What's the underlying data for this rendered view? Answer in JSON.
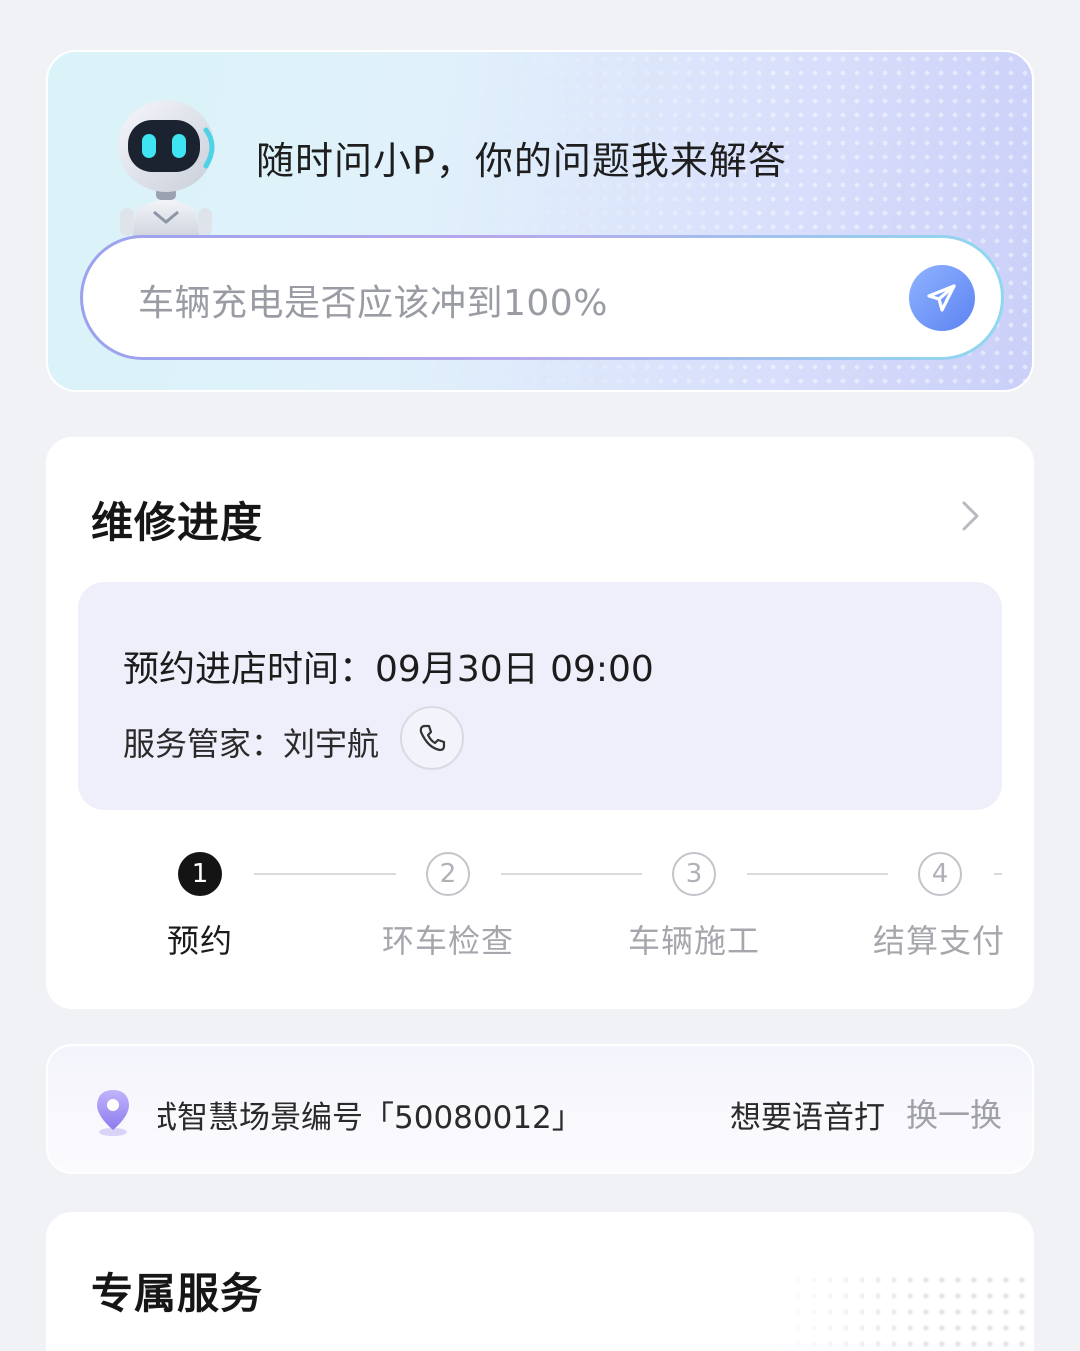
{
  "assistant": {
    "tagline": "随时问小P，你的问题我来解答",
    "input_placeholder": "车辆充电是否应该冲到100%",
    "send_icon": "paper-plane-icon"
  },
  "repair": {
    "title": "维修进度",
    "appointment_label": "预约进店时间：",
    "appointment_time": "09月30日 09:00",
    "advisor_label": "服务管家：",
    "advisor_name": "刘宇航",
    "steps": [
      {
        "num": "1",
        "label": "预约",
        "state": "active"
      },
      {
        "num": "2",
        "label": "环车检查",
        "state": "todo"
      },
      {
        "num": "3",
        "label": "车辆施工",
        "state": "todo"
      },
      {
        "num": "4",
        "label": "结算支付",
        "state": "todo"
      }
    ]
  },
  "ticker": {
    "item_1": "试智慧场景编号「50080012」",
    "item_2": "想要语音打",
    "shuffle_label": "换一换"
  },
  "service": {
    "title": "专属服务"
  },
  "colors": {
    "page_bg": "#f1f2f6",
    "accent_blue": "#5c83f2",
    "active_step": "#141414",
    "inactive_step": "#a6a7ad",
    "pin": "#9b8cf0"
  }
}
